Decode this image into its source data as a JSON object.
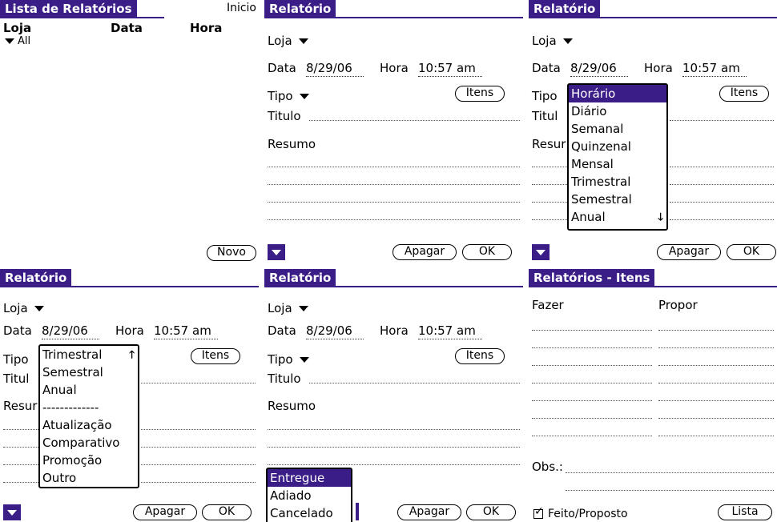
{
  "list": {
    "title": "Lista de Relatórios",
    "inicio": "Inicio",
    "col_loja": "Loja",
    "col_data": "Data",
    "col_hora": "Hora",
    "filter": "All",
    "novo": "Novo"
  },
  "form": {
    "title": "Relatório",
    "loja": "Loja",
    "data_label": "Data",
    "data_value": "8/29/06",
    "hora_label": "Hora",
    "hora_value": "10:57 am",
    "tipo": "Tipo",
    "titulo": "Titulo",
    "resumo": "Resumo",
    "itens": "Itens",
    "apagar": "Apagar",
    "ok": "OK",
    "tipo_cut": "Tipo",
    "titulo_cut": "Titul",
    "resumo_cut": "Resur"
  },
  "tipo_list_1": {
    "items": [
      "Horário",
      "Diário",
      "Semanal",
      "Quinzenal",
      "Mensal",
      "Trimestral",
      "Semestral",
      "Anual"
    ],
    "selected": "Horário"
  },
  "tipo_list_2": {
    "items": [
      "Trimestral",
      "Semestral",
      "Anual",
      "-------------",
      "Atualização",
      "Comparativo",
      "Promoção",
      "Outro"
    ]
  },
  "status_list": {
    "items": [
      "Entregue",
      "Adiado",
      "Cancelado"
    ],
    "selected": "Entregue"
  },
  "itens": {
    "title": "Relatórios - Itens",
    "fazer": "Fazer",
    "propor": "Propor",
    "obs": "Obs.:",
    "feito": "Feito/Proposto",
    "lista": "Lista"
  },
  "colors": {
    "accent": "#3a1d86"
  }
}
